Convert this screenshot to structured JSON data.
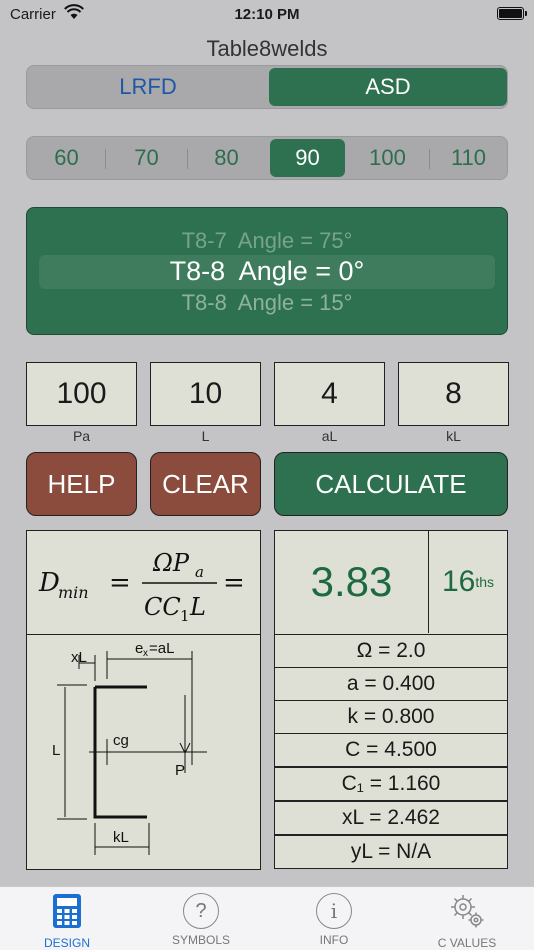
{
  "status": {
    "carrier": "Carrier",
    "time": "12:10 PM"
  },
  "app": {
    "title": "Table8welds"
  },
  "segment": {
    "lrfd": "LRFD",
    "asd": "ASD",
    "selected": "ASD"
  },
  "electrodes": {
    "options": [
      "60",
      "70",
      "80",
      "90",
      "100",
      "110"
    ],
    "selected": "90"
  },
  "picker": {
    "prev": "T8-7  Angle = 75°",
    "current": "T8-8  Angle = 0°",
    "next": "T8-8  Angle = 15°"
  },
  "inputs": [
    {
      "value": "100",
      "label": "Pa"
    },
    {
      "value": "10",
      "label": "L"
    },
    {
      "value": "4",
      "label": "aL"
    },
    {
      "value": "8",
      "label": "kL"
    }
  ],
  "buttons": {
    "help": "HELP",
    "clear": "CLEAR",
    "calculate": "CALCULATE"
  },
  "formula": {
    "lhs": "D",
    "lhs_sub": "min",
    "numerator": "ΩP",
    "numerator_sub": "a",
    "denominator": "CC",
    "denominator_sub": "1",
    "denominator_tail": "L"
  },
  "diagram": {
    "xL": "xL",
    "ex": "e",
    "ex_sub": "x",
    "ex_tail": "=aL",
    "L": "L",
    "cg": "cg",
    "P": "P",
    "kL": "kL"
  },
  "result": {
    "value": "3.83",
    "unit": "16",
    "unit_sup": "ths"
  },
  "coefficients": [
    "Ω = 2.0",
    "a = 0.400",
    "k = 0.800",
    "C = 4.500",
    "C₁ = 1.160",
    "xL = 2.462",
    "yL = N/A"
  ],
  "tabs": [
    {
      "label": "DESIGN",
      "icon": "calculator-icon",
      "active": true
    },
    {
      "label": "SYMBOLS",
      "icon": "question-icon",
      "active": false
    },
    {
      "label": "INFO",
      "icon": "info-icon",
      "active": false
    },
    {
      "label": "C VALUES",
      "icon": "gears-icon",
      "active": false
    }
  ],
  "colors": {
    "accent_green": "#2e7150",
    "red_button": "#8b4c3e",
    "blue": "#1f57a8",
    "tab_active": "#1a6fd1"
  }
}
